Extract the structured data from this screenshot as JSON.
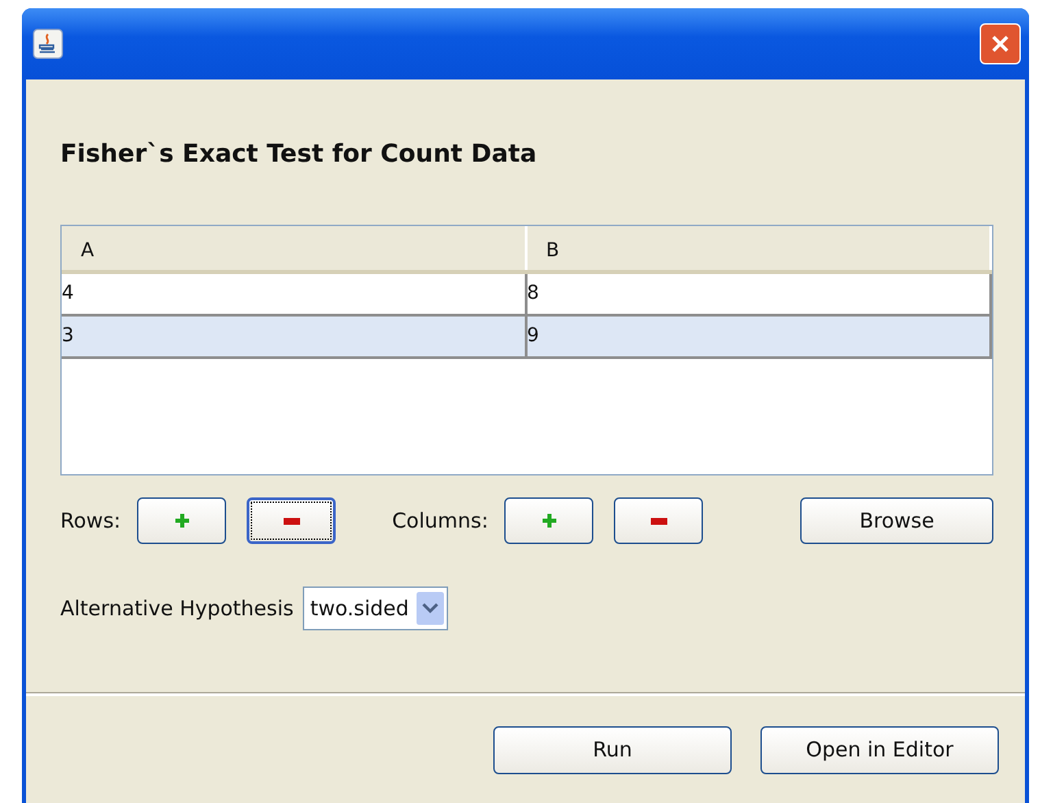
{
  "heading": "Fisher`s Exact Test for Count Data",
  "table": {
    "columns": [
      "A",
      "B"
    ],
    "rows": [
      {
        "cells": [
          "4",
          "8"
        ],
        "selected": false
      },
      {
        "cells": [
          "3",
          "9"
        ],
        "selected": true
      }
    ]
  },
  "rows_label": "Rows:",
  "rows_buttons": [
    {
      "kind": "add",
      "focused": false
    },
    {
      "kind": "remove",
      "focused": true
    }
  ],
  "columns_label": "Columns:",
  "columns_buttons": [
    {
      "kind": "add",
      "focused": false
    },
    {
      "kind": "remove",
      "focused": false
    }
  ],
  "browse": "Browse",
  "hypothesis_label": "Alternative Hypothesis",
  "hypothesis_value": "two.sided",
  "buttons": [
    "Run",
    "Open in Editor"
  ]
}
